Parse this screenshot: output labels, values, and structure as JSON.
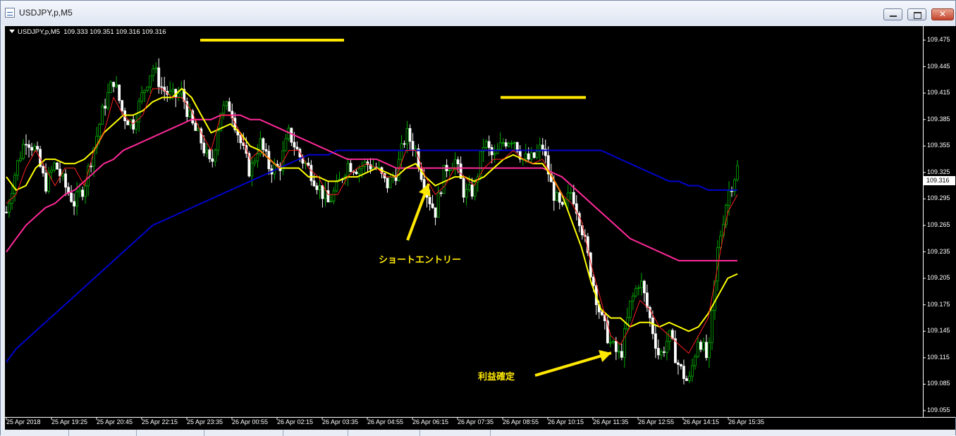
{
  "window": {
    "title": "USDJPY,p,M5",
    "buttons": [
      "minimize-icon",
      "maximize-icon",
      "close-icon"
    ]
  },
  "chart_info": {
    "symbol": "USDJPY,p,M5",
    "ohlc": "109.333 109.351 109.316 109.316"
  },
  "annotations": {
    "entry_label": "ショートエントリー",
    "exit_label": "利益確定"
  },
  "current_price": "109.316",
  "colors": {
    "background": "#000000",
    "bull_candle": "#00b000",
    "bear_candle": "#ffffff",
    "ma_fast": "#ff2020",
    "ma_mid": "#ffff00",
    "ma_slow": "#ff2a9a",
    "ma_long": "#0000cc",
    "annotation": "#ffe800"
  },
  "chart_data": {
    "type": "candlestick",
    "ylim": [
      109.045,
      109.49
    ],
    "price_ticks": [
      "109.475",
      "109.445",
      "109.415",
      "109.385",
      "109.355",
      "109.325",
      "109.295",
      "109.265",
      "109.235",
      "109.205",
      "109.175",
      "109.145",
      "109.115",
      "109.085",
      "109.055"
    ],
    "time_ticks": [
      "25 Apr 2018",
      "25 Apr 19:25",
      "25 Apr 20:45",
      "25 Apr 22:15",
      "25 Apr 23:35",
      "26 Apr 00:55",
      "26 Apr 02:15",
      "26 Apr 03:35",
      "26 Apr 04:55",
      "26 Apr 06:15",
      "26 Apr 07:35",
      "26 Apr 08:55",
      "26 Apr 10:15",
      "26 Apr 11:35",
      "26 Apr 12:55",
      "26 Apr 14:15",
      "26 Apr 15:35"
    ],
    "close_path": [
      109.28,
      109.33,
      109.365,
      109.35,
      109.31,
      109.335,
      109.31,
      109.29,
      109.31,
      109.355,
      109.4,
      109.43,
      109.39,
      109.38,
      109.415,
      109.445,
      109.42,
      109.41,
      109.415,
      109.38,
      109.36,
      109.33,
      109.395,
      109.4,
      109.36,
      109.325,
      109.36,
      109.33,
      109.33,
      109.37,
      109.345,
      109.33,
      109.31,
      109.29,
      109.31,
      109.335,
      109.33,
      109.335,
      109.33,
      109.31,
      109.325,
      109.37,
      109.35,
      109.305,
      109.28,
      109.33,
      109.34,
      109.3,
      109.305,
      109.36,
      109.34,
      109.36,
      109.365,
      109.34,
      109.34,
      109.355,
      109.305,
      109.28,
      109.305,
      109.265,
      109.21,
      109.16,
      109.13,
      109.115,
      109.175,
      109.205,
      109.16,
      109.115,
      109.14,
      109.105,
      109.085,
      109.14,
      109.11,
      109.24,
      109.3,
      109.33
    ],
    "ma_fast": [
      109.29,
      109.3,
      109.33,
      109.35,
      109.33,
      109.31,
      109.33,
      109.33,
      109.31,
      109.35,
      109.37,
      109.41,
      109.39,
      109.38,
      109.39,
      109.42,
      109.42,
      109.41,
      109.41,
      109.395,
      109.37,
      109.35,
      109.39,
      109.39,
      109.37,
      109.34,
      109.35,
      109.34,
      109.33,
      109.35,
      109.35,
      109.33,
      109.32,
      109.3,
      109.3,
      109.32,
      109.33,
      109.335,
      109.33,
      109.32,
      109.32,
      109.35,
      109.35,
      109.32,
      109.3,
      109.31,
      109.33,
      109.32,
      109.31,
      109.33,
      109.34,
      109.34,
      109.35,
      109.34,
      109.335,
      109.34,
      109.32,
      109.3,
      109.29,
      109.27,
      109.22,
      109.18,
      109.14,
      109.13,
      109.15,
      109.18,
      109.17,
      109.15,
      109.14,
      109.13,
      109.12,
      109.14,
      109.16,
      109.22,
      109.28,
      109.3
    ],
    "ma_mid": [
      109.32,
      109.305,
      109.31,
      109.33,
      109.34,
      109.34,
      109.335,
      109.335,
      109.34,
      109.35,
      109.37,
      109.38,
      109.39,
      109.39,
      109.395,
      109.405,
      109.41,
      109.41,
      109.42,
      109.41,
      109.39,
      109.37,
      109.375,
      109.38,
      109.37,
      109.355,
      109.35,
      109.34,
      109.33,
      109.33,
      109.33,
      109.32,
      109.32,
      109.315,
      109.315,
      109.32,
      109.32,
      109.325,
      109.33,
      109.325,
      109.32,
      109.33,
      109.335,
      109.32,
      109.31,
      109.315,
      109.32,
      109.32,
      109.315,
      109.32,
      109.33,
      109.34,
      109.345,
      109.34,
      109.335,
      109.335,
      109.32,
      109.3,
      109.27,
      109.24,
      109.2,
      109.17,
      109.16,
      109.16,
      109.15,
      109.155,
      109.155,
      109.15,
      109.155,
      109.15,
      109.145,
      109.15,
      109.165,
      109.185,
      109.205,
      109.21
    ],
    "ma_slow": [
      109.235,
      109.25,
      109.265,
      109.275,
      109.285,
      109.29,
      109.3,
      109.305,
      109.315,
      109.325,
      109.335,
      109.34,
      109.35,
      109.355,
      109.36,
      109.365,
      109.37,
      109.375,
      109.38,
      109.385,
      109.385,
      109.385,
      109.39,
      109.39,
      109.39,
      109.385,
      109.385,
      109.38,
      109.375,
      109.37,
      109.365,
      109.36,
      109.355,
      109.35,
      109.345,
      109.34,
      109.34,
      109.34,
      109.34,
      109.335,
      109.33,
      109.33,
      109.33,
      109.33,
      109.33,
      109.33,
      109.33,
      109.33,
      109.33,
      109.33,
      109.33,
      109.33,
      109.33,
      109.33,
      109.33,
      109.33,
      109.325,
      109.32,
      109.31,
      109.3,
      109.29,
      109.28,
      109.27,
      109.26,
      109.25,
      109.245,
      109.24,
      109.235,
      109.23,
      109.225,
      109.225,
      109.225,
      109.225,
      109.225,
      109.225,
      109.225
    ],
    "ma_long": [
      109.11,
      109.125,
      109.135,
      109.145,
      109.155,
      109.165,
      109.175,
      109.185,
      109.195,
      109.205,
      109.215,
      109.225,
      109.235,
      109.245,
      109.255,
      109.265,
      109.27,
      109.275,
      109.28,
      109.285,
      109.29,
      109.295,
      109.3,
      109.305,
      109.31,
      109.315,
      109.32,
      109.325,
      109.33,
      109.335,
      109.34,
      109.345,
      109.345,
      109.345,
      109.35,
      109.35,
      109.35,
      109.35,
      109.35,
      109.35,
      109.35,
      109.35,
      109.35,
      109.35,
      109.35,
      109.35,
      109.35,
      109.35,
      109.35,
      109.35,
      109.35,
      109.35,
      109.35,
      109.35,
      109.35,
      109.35,
      109.35,
      109.35,
      109.35,
      109.35,
      109.35,
      109.35,
      109.345,
      109.34,
      109.335,
      109.33,
      109.325,
      109.32,
      109.315,
      109.315,
      109.31,
      109.31,
      109.305,
      109.305,
      109.305,
      109.305
    ],
    "resistance_lines": [
      109.475,
      109.41
    ]
  }
}
